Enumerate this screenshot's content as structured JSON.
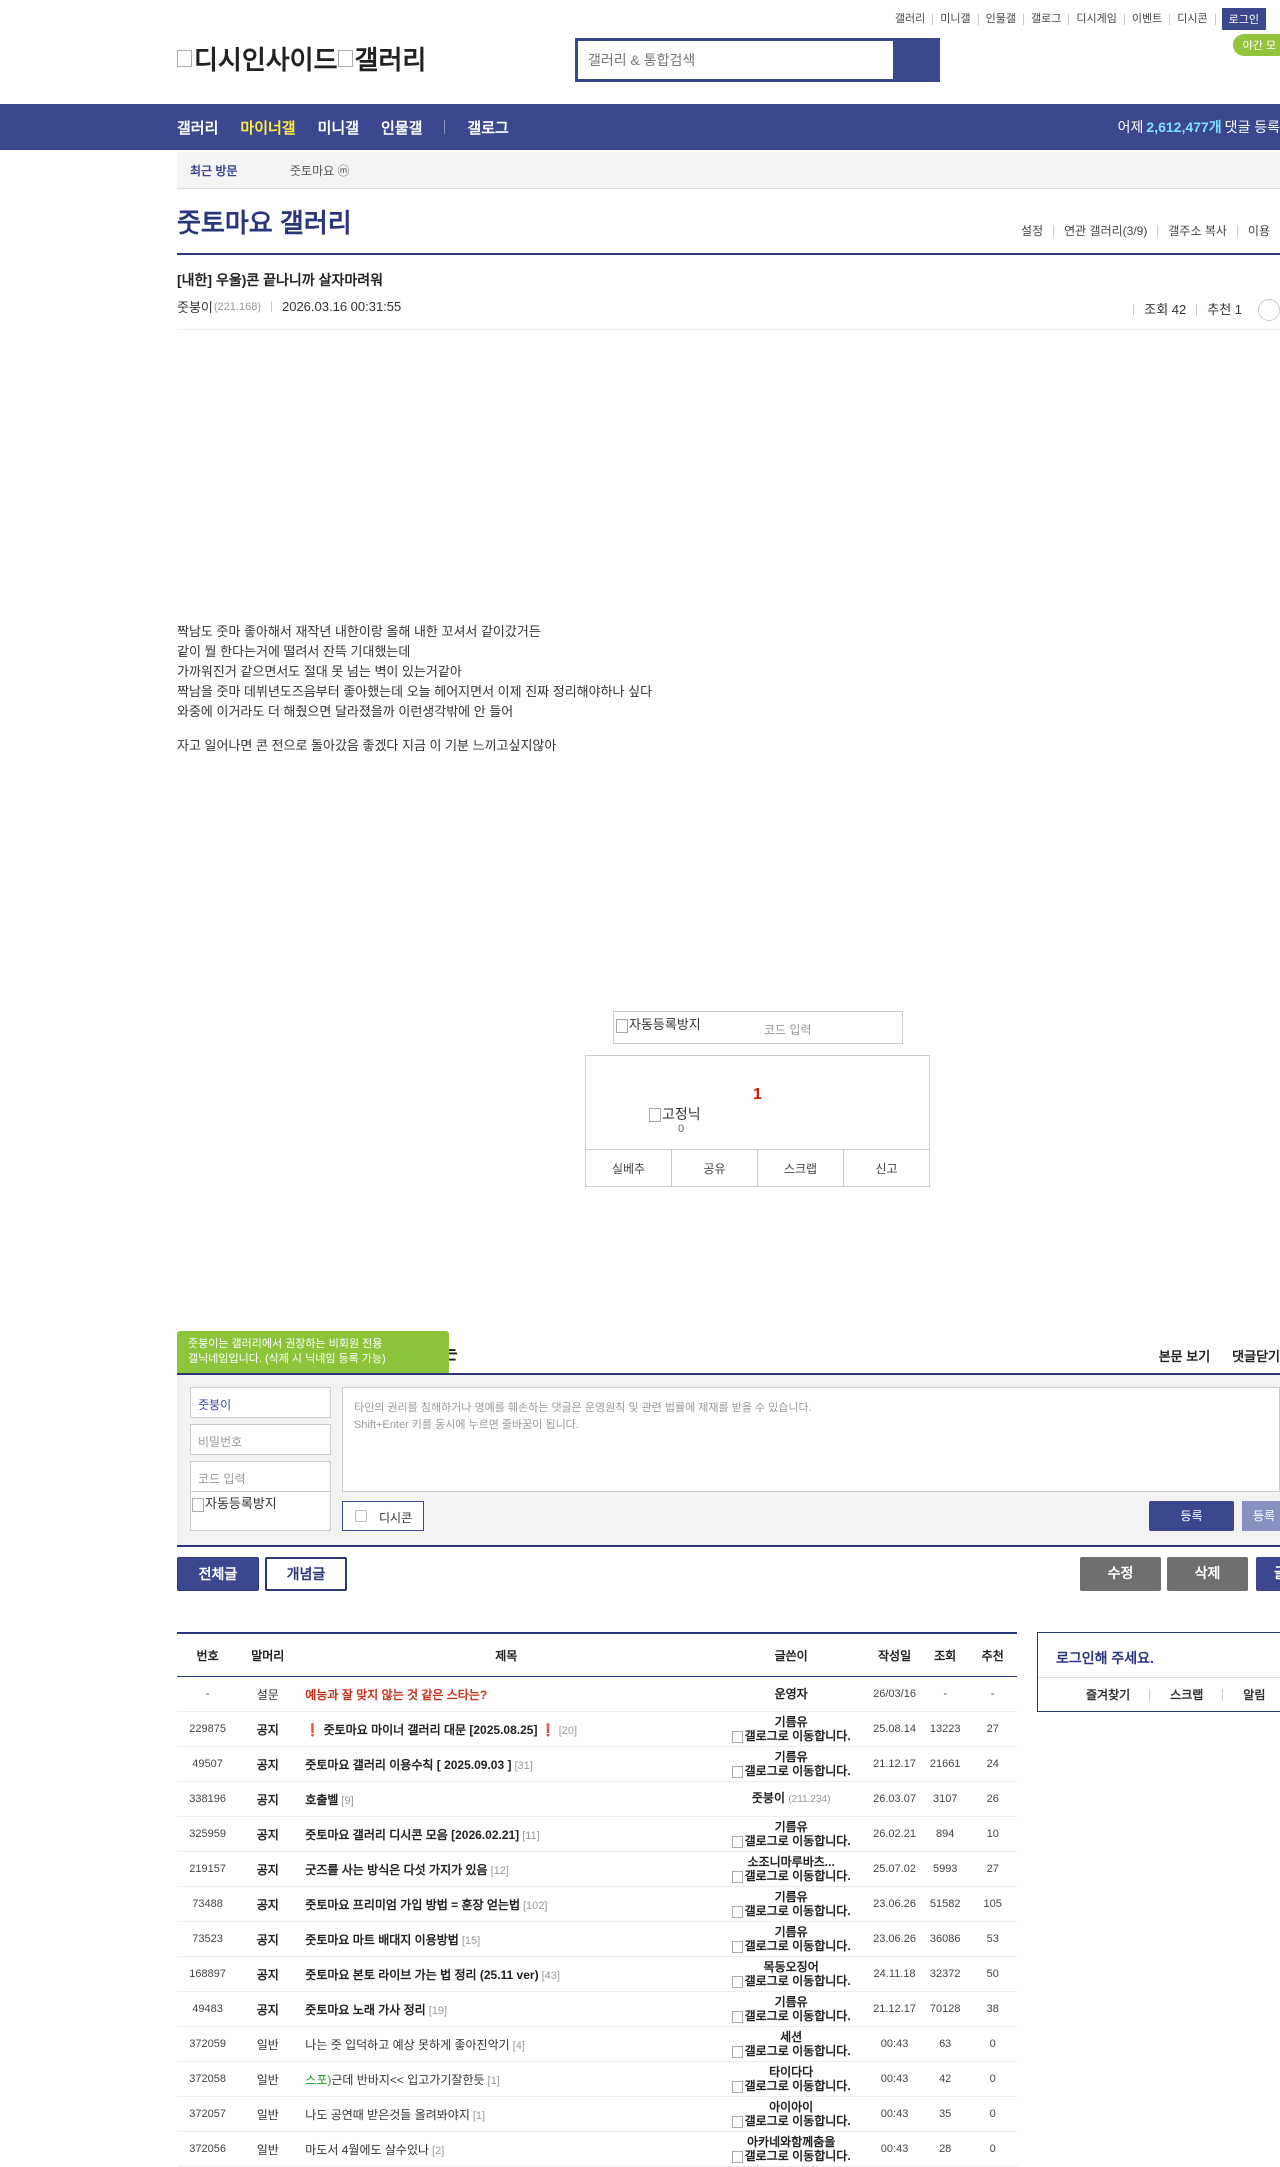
{
  "util": {
    "links": [
      "갤러리",
      "미니갤",
      "인물갤",
      "갤로그",
      "디시게임",
      "이벤트",
      "디시콘"
    ],
    "login": "로그인",
    "night": "야간 모"
  },
  "logo": "디시인사이드",
  "logo_gallery": "갤러리",
  "search": {
    "placeholder": "갤러리 & 통합검색"
  },
  "gnb": {
    "items": [
      "갤러리",
      "마이너갤",
      "미니갤",
      "인물갤",
      "갤로그"
    ],
    "stat_prefix": "어제",
    "stat_num": "2,612,477개",
    "stat_suffix": "댓글 등록"
  },
  "recent": {
    "label": "최근 방문",
    "item": "줏토마요 ⓜ"
  },
  "gallery": {
    "title": "줏토마요 갤러리",
    "tools": [
      "설정",
      "연관 갤러리(3/9)",
      "갤주소 복사",
      "이용"
    ]
  },
  "post": {
    "title": "[내한] 우울)콘 끝나니까 살자마려워",
    "author": "줏붕이",
    "ip": "(221.168)",
    "date": "2026.03.16 00:31:55",
    "views": "조회 42",
    "reco": "추천 1",
    "body": [
      "짝남도 줏마 좋아해서 재작년 내한이랑 올해 내한 꼬셔서 같이갔거든",
      "같이 뭘 한다는거에 떨려서 잔뜩 기대했는데",
      "가까워진거 같으면서도 절대 못 넘는 벽이 있는거같아",
      "짝남을 줏마 데뷔년도즈음부터 좋아했는데 오늘 헤어지면서 이제 진짜 정리해야하나 싶다",
      "와중에 이거라도 더 해줬으면 달라졌을까 이런생각밖에 안 들어"
    ],
    "body2": "자고 일어나면 콘 전으로 돌아갔음 좋겠다 지금 이 기분 느끼고싶지않아"
  },
  "captcha": {
    "alt": "자동등록방지",
    "placeholder": "코드 입력"
  },
  "recobox": {
    "count": "1",
    "fixed": "고정닉",
    "fixed_count": "0",
    "buttons": [
      "실베추",
      "공유",
      "스크랩",
      "신고"
    ]
  },
  "comment": {
    "tooltip1": "줏붕이는 갤러리에서 권장하는 비회원 전용",
    "tooltip2": "갤닉네임입니다. (삭제 시 닉네임 등록 가능)",
    "tail": "는",
    "view_body": "본문 보기",
    "close": "댓글닫기",
    "nick": "줏붕이",
    "pw_placeholder": "비밀번호",
    "code_placeholder": "코드 입력",
    "captcha_alt": "자동등록방지",
    "notice1": "타인의 권리를 침해하거나 명예를 훼손하는 댓글은 운영원칙 및 관련 법률에 제재를 받을 수 있습니다.",
    "notice2": "Shift+Enter 키를 동시에 누르면 줄바꿈이 됩니다.",
    "dccon": "디시콘",
    "submit": "등록",
    "submit_reco": "등록"
  },
  "list_buttons": {
    "all": "전체글",
    "concept": "개념글",
    "edit": "수정",
    "delete": "삭제",
    "write": "글"
  },
  "table": {
    "headers": [
      "번호",
      "말머리",
      "제목",
      "글쓴이",
      "작성일",
      "조회",
      "추천"
    ],
    "rows": [
      {
        "num": "-",
        "head": "설문",
        "title": "예능과 잘 맞지 않는 것 같은 스타는?",
        "rc": "",
        "writer": "운영자",
        "wlink": "",
        "date": "26/03/16",
        "views": "-",
        "reco": "-",
        "type": "survey"
      },
      {
        "num": "229875",
        "head": "공지",
        "title": "❗ 줏토마요 마이너 갤러리 대문 [2025.08.25] ❗",
        "rc": "[20]",
        "writer": "기름유",
        "wlink": "갤로그로 이동합니다.",
        "date": "25.08.14",
        "views": "13223",
        "reco": "27",
        "type": "notice"
      },
      {
        "num": "49507",
        "head": "공지",
        "title": "줏토마요 갤러리 이용수칙 [ 2025.09.03 ]",
        "rc": "[31]",
        "writer": "기름유",
        "wlink": "갤로그로 이동합니다.",
        "date": "21.12.17",
        "views": "21661",
        "reco": "24",
        "type": "notice"
      },
      {
        "num": "338196",
        "head": "공지",
        "title": "호출벨",
        "rc": "[9]",
        "writer": "줏붕이",
        "wip": "(211.234)",
        "wlink": "",
        "date": "26.03.07",
        "views": "3107",
        "reco": "26",
        "type": "notice"
      },
      {
        "num": "325959",
        "head": "공지",
        "title": "줏토마요 갤러리 디시콘 모음 [2026.02.21]",
        "rc": "[11]",
        "writer": "기름유",
        "wlink": "갤로그로 이동합니다.",
        "date": "26.02.21",
        "views": "894",
        "reco": "10",
        "type": "notice"
      },
      {
        "num": "219157",
        "head": "공지",
        "title": "굿즈를 사는 방식은 다섯 가지가 있음",
        "rc": "[12]",
        "writer": "소조니마루바츠...",
        "wlink": "갤로그로 이동합니다.",
        "date": "25.07.02",
        "views": "5993",
        "reco": "27",
        "type": "notice"
      },
      {
        "num": "73488",
        "head": "공지",
        "title": "줏토마요 프리미엄 가입 방법 = 훈장 얻는법",
        "rc": "[102]",
        "writer": "기름유",
        "wlink": "갤로그로 이동합니다.",
        "date": "23.06.26",
        "views": "51582",
        "reco": "105",
        "type": "notice"
      },
      {
        "num": "73523",
        "head": "공지",
        "title": "줏토마요 마트 배대지 이용방법",
        "rc": "[15]",
        "writer": "기름유",
        "wlink": "갤로그로 이동합니다.",
        "date": "23.06.26",
        "views": "36086",
        "reco": "53",
        "type": "notice"
      },
      {
        "num": "168897",
        "head": "공지",
        "title": "줏토마요 본토 라이브 가는 법 정리 (25.11 ver)",
        "rc": "[43]",
        "writer": "목동오징어",
        "wlink": "갤로그로 이동합니다.",
        "date": "24.11.18",
        "views": "32372",
        "reco": "50",
        "type": "notice"
      },
      {
        "num": "49483",
        "head": "공지",
        "title": "줏토마요 노래 가사 정리",
        "rc": "[19]",
        "writer": "기름유",
        "wlink": "갤로그로 이동합니다.",
        "date": "21.12.17",
        "views": "70128",
        "reco": "38",
        "type": "notice"
      },
      {
        "num": "372059",
        "head": "일반",
        "title": "나는 줏 입덕하고 예상 못하게 좋아진악기",
        "rc": "[4]",
        "writer": "세션",
        "wlink": "갤로그로 이동합니다.",
        "date": "00:43",
        "views": "63",
        "reco": "0",
        "type": "plain"
      },
      {
        "num": "372058",
        "head": "일반",
        "title_green": "스포)",
        "title": "근데 반바지<< 입고가기잘한듯",
        "rc": "[1]",
        "writer": "타이다다",
        "wlink": "갤로그로 이동합니다.",
        "date": "00:43",
        "views": "42",
        "reco": "0",
        "type": "plain"
      },
      {
        "num": "372057",
        "head": "일반",
        "title": "나도 공연때 받은것들 올려봐야지",
        "rc": "[1]",
        "writer": "아이아이",
        "wlink": "갤로그로 이동합니다.",
        "date": "00:43",
        "views": "35",
        "reco": "0",
        "type": "plain"
      },
      {
        "num": "372056",
        "head": "일반",
        "title": "마도서 4월에도 살수있나",
        "rc": "[2]",
        "writer": "아카네와함께춤을",
        "wlink": "갤로그로 이동합니다.",
        "date": "00:43",
        "views": "28",
        "reco": "0",
        "type": "plain"
      }
    ]
  },
  "loginbox": {
    "title": "로그인해 주세요.",
    "links": [
      "즐겨찾기",
      "스크랩",
      "알림"
    ]
  }
}
